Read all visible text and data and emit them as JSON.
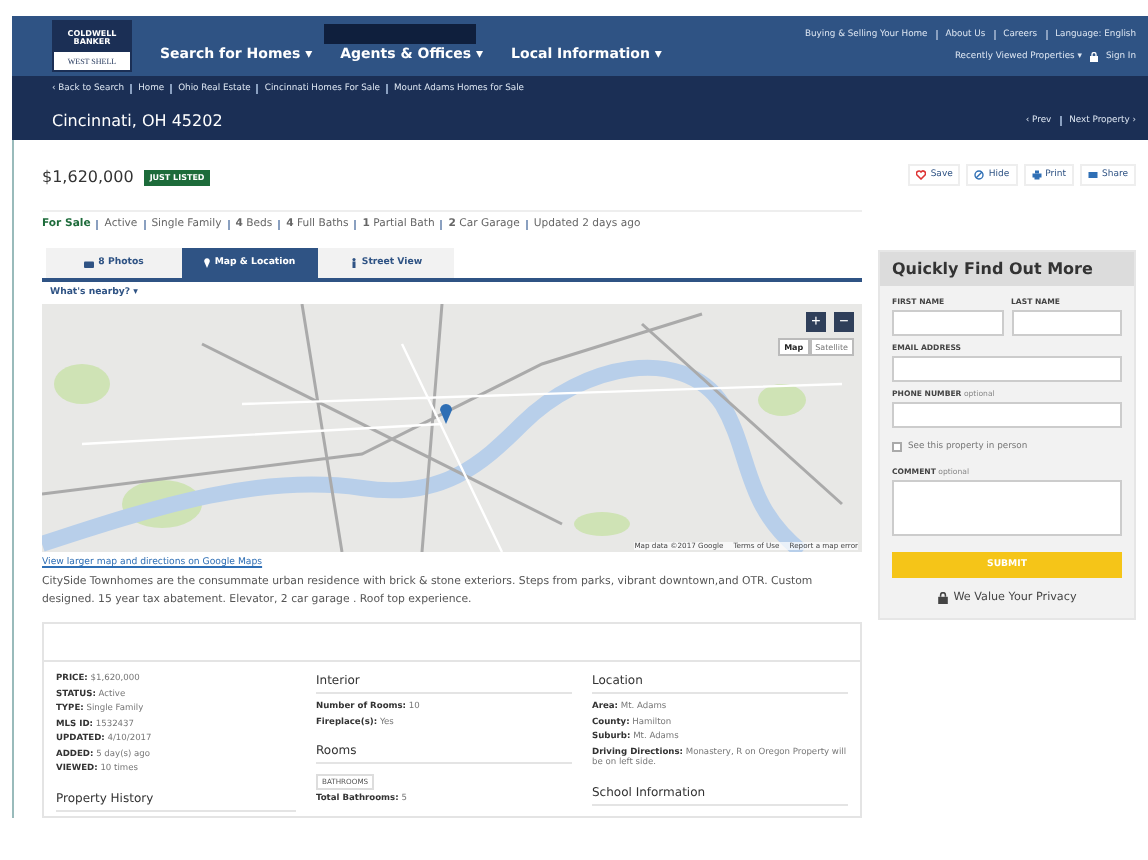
{
  "header": {
    "logo_top": "COLDWELL BANKER",
    "logo_bottom": "WEST SHELL",
    "nav": [
      {
        "label": "Search for Homes",
        "caret": "▾"
      },
      {
        "label": "Agents & Offices",
        "caret": "▾"
      },
      {
        "label": "Local Information",
        "caret": "▾"
      }
    ],
    "top_links": [
      "Buying & Selling Your Home",
      "About Us",
      "Careers",
      "Language: English"
    ],
    "recently_viewed": "Recently Viewed Properties ▾",
    "sign_in": "Sign In"
  },
  "breadcrumbs": [
    "‹ Back to Search",
    "Home",
    "Ohio Real Estate",
    "Cincinnati Homes For Sale",
    "Mount Adams Homes for Sale"
  ],
  "title": "Cincinnati, OH 45202",
  "pager": [
    "‹ Prev",
    "Next Property ›"
  ],
  "price": "$1,620,000",
  "badge": "JUST LISTED",
  "actions": [
    {
      "label": "Save",
      "kind": "heart"
    },
    {
      "label": "Hide",
      "kind": "hide"
    },
    {
      "label": "Print",
      "kind": "print"
    },
    {
      "label": "Share",
      "kind": "share"
    }
  ],
  "facts": [
    {
      "text": "For Sale",
      "kind": "status"
    },
    {
      "text": "Active",
      "kind": "plain"
    },
    {
      "text": "Single Family",
      "kind": "plain"
    },
    {
      "text": "**4** Beds",
      "kind": "plain"
    },
    {
      "text": "**4** Full Baths",
      "kind": "plain"
    },
    {
      "text": "**1** Partial Bath",
      "kind": "plain"
    },
    {
      "text": "**2** Car Garage",
      "kind": "plain"
    },
    {
      "text": "Updated 2 days ago",
      "kind": "plain"
    }
  ],
  "tabs": [
    {
      "label": "8 Photos",
      "kind": "camera",
      "selected": false
    },
    {
      "label": "Map & Location",
      "kind": "pin",
      "selected": true
    },
    {
      "label": "Street View",
      "kind": "street",
      "selected": false
    }
  ],
  "nearby": "What's nearby? ▾",
  "map": {
    "zoom_in": "+",
    "zoom_out": "−",
    "types": [
      {
        "label": "Map",
        "selected": true
      },
      {
        "label": "Satellite",
        "selected": false
      }
    ],
    "footer": [
      "Map data ©2017 Google",
      "Terms of Use",
      "Report a map error"
    ]
  },
  "map_link": "View larger map and directions on Google Maps",
  "description": "CitySide Townhomes are the consummate urban residence with brick & stone exteriors. Steps from parks, vibrant downtown,and OTR. Custom designed. 15 year tax abatement. Elevator, 2 car garage . Roof top experience.",
  "summary": [
    {
      "label": "PRICE:",
      "value": "$1,620,000"
    },
    {
      "label": "STATUS:",
      "value": "Active"
    },
    {
      "label": "TYPE:",
      "value": "Single Family"
    },
    {
      "label": "MLS ID:",
      "value": "1532437"
    },
    {
      "label": "UPDATED:",
      "value": "4/10/2017"
    },
    {
      "label": "ADDED:",
      "value": "5 day(s) ago"
    },
    {
      "label": "VIEWED:",
      "value": "10 times"
    }
  ],
  "property_history": "Property History",
  "interior": {
    "title": "Interior",
    "rows": [
      {
        "label": "Number of Rooms:",
        "value": "10"
      },
      {
        "label": "Fireplace(s):",
        "value": "Yes"
      }
    ],
    "rooms_title": "Rooms",
    "rooms_tag": "BATHROOMS",
    "rooms_rows": [
      {
        "label": "Total Bathrooms:",
        "value": "5"
      }
    ]
  },
  "location": {
    "title": "Location",
    "rows": [
      {
        "label": "Area:",
        "value": "Mt. Adams"
      },
      {
        "label": "County:",
        "value": "Hamilton"
      },
      {
        "label": "Suburb:",
        "value": "Mt. Adams"
      },
      {
        "label": "Driving Directions:",
        "value": "Monastery, R on Oregon Property will be on left side."
      }
    ],
    "school_title": "School Information"
  },
  "form": {
    "title": "Quickly Find Out More",
    "fields": [
      {
        "label": "FIRST NAME",
        "kind": "half"
      },
      {
        "label": "LAST NAME",
        "kind": "half"
      },
      {
        "label": "EMAIL ADDRESS",
        "kind": "full"
      },
      {
        "label": "PHONE NUMBER",
        "optional": "optional",
        "kind": "full"
      }
    ],
    "checkbox": {
      "label": "See this property in person",
      "checked": false
    },
    "comment_label": "COMMENT",
    "comment_optional": "optional",
    "submit": "SUBMIT",
    "privacy": "We Value Your Privacy"
  }
}
